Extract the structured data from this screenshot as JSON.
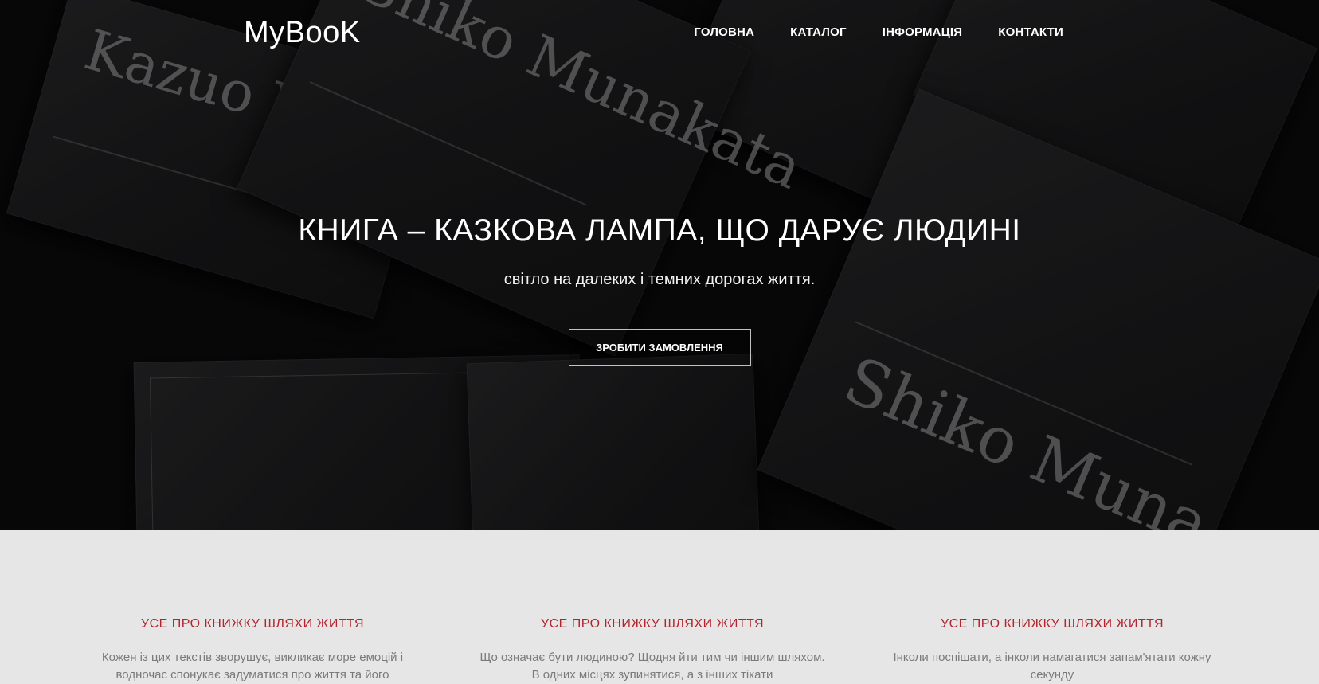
{
  "nav": {
    "logo": "MyBooK",
    "items": [
      {
        "label": "ГОЛОВНА"
      },
      {
        "label": "КАТАЛОГ"
      },
      {
        "label": "ІНФОРМАЦІЯ"
      },
      {
        "label": "КОНТАКТИ"
      }
    ]
  },
  "hero": {
    "title": "КНИГА – КАЗКОВА ЛАМПА, ЩО ДАРУЄ ЛЮДИНІ",
    "subtitle": "світло на далеких і темних дорогах життя.",
    "cta_label": "ЗРОБИТИ ЗАМОВЛЕННЯ",
    "background_text": {
      "book1": "Kazuo Yagi",
      "book2": "Shiko Munakata",
      "book5": "Shiko Muna"
    }
  },
  "features": [
    {
      "heading": "УСЕ ПРО КНИЖКУ ШЛЯХИ ЖИТТЯ",
      "text": "Кожен із цих текстів зворушує, викликає море емоцій і водночас спонукає задуматися про життя та його"
    },
    {
      "heading": "УСЕ ПРО КНИЖКУ ШЛЯХИ ЖИТТЯ",
      "text": "Що означає бути людиною? Щодня йти тим чи іншим шляхом. В одних місцях зупинятися, а з інших тікати"
    },
    {
      "heading": "УСЕ ПРО КНИЖКУ ШЛЯХИ ЖИТТЯ",
      "text": "Інколи поспішати, а інколи намагатися запам'ятати кожну секунду"
    }
  ],
  "colors": {
    "accent": "#b3242c",
    "hero_bg": "#0c0c0d",
    "section_bg": "#e6e6e6"
  }
}
